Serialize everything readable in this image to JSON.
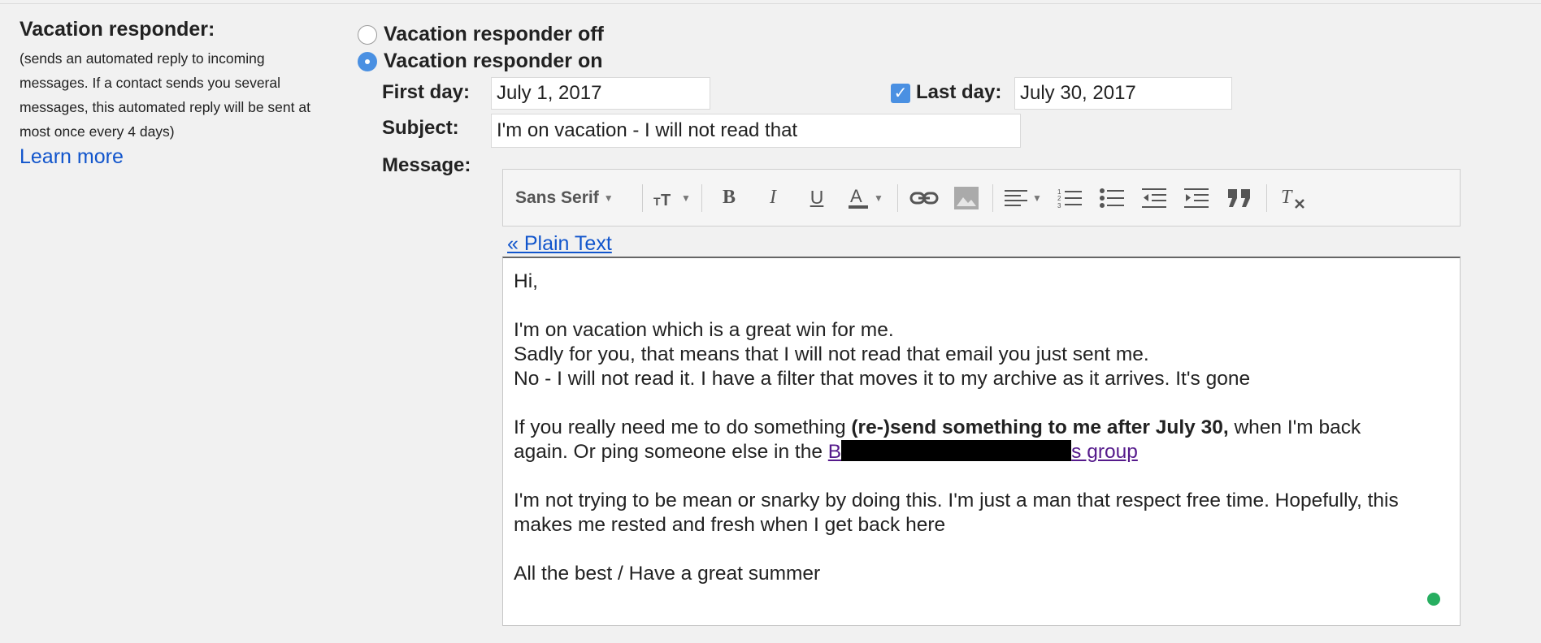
{
  "left": {
    "title": "Vacation responder:",
    "description": "(sends an automated reply to incoming messages. If a contact sends you several messages, this automated reply will be sent at most once every 4 days)",
    "learn_more": "Learn more"
  },
  "responder": {
    "off_label": "Vacation responder off",
    "on_label": "Vacation responder on",
    "selected": "on"
  },
  "form": {
    "first_day_label": "First day:",
    "first_day_value": "July 1, 2017",
    "last_day_label": "Last day:",
    "last_day_checked": true,
    "last_day_value": "July 30, 2017",
    "subject_label": "Subject:",
    "subject_value": "I'm on vacation - I will not read that",
    "message_label": "Message:"
  },
  "toolbar": {
    "font_label": "Sans Serif",
    "icons": [
      "font-size-icon",
      "bold-icon",
      "italic-icon",
      "underline-icon",
      "text-color-icon",
      "link-icon",
      "image-icon",
      "align-icon",
      "numbered-list-icon",
      "bulleted-list-icon",
      "indent-less-icon",
      "indent-more-icon",
      "quote-icon",
      "remove-formatting-icon"
    ]
  },
  "plain_text_link": "« Plain Text",
  "message": {
    "greeting": "Hi,",
    "line1": "I'm on vacation which is a great win for me.",
    "line2": "Sadly for you, that means that I will not read that email you just sent me.",
    "line3": "No - I will not read it. I have a filter that moves it to my archive as it arrives. It's gone",
    "p2_start": "If you really need me to do something ",
    "p2_bold": "(re-)send something to me after July 30,",
    "p2_end": " when I'm back",
    "p2_line2_start": "again. Or ping someone else in the ",
    "link_prefix": "B",
    "link_suffix": "s group",
    "p3": "I'm not trying to be mean or snarky by doing this. I'm just a man that respect free time. Hopefully, this makes me rested and fresh when I get back here",
    "signoff": "All the best / Have a great summer"
  },
  "colors": {
    "link": "#1155cc",
    "visited_link": "#551a8b",
    "accent": "#4a90e2",
    "status_dot": "#27ae60"
  }
}
